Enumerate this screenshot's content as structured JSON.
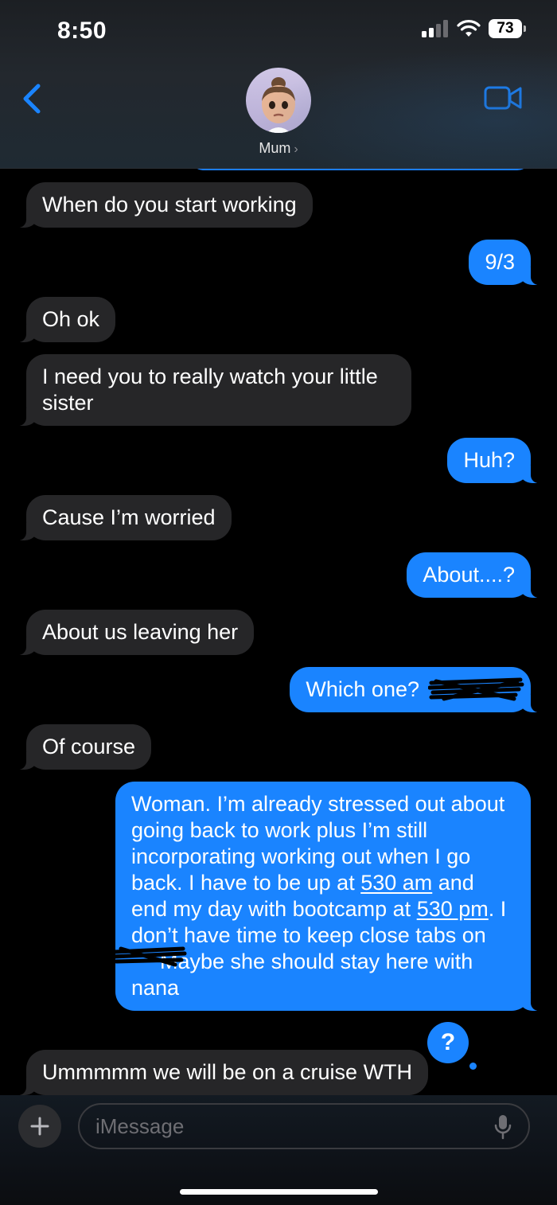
{
  "status_bar": {
    "time": "8:50",
    "battery": "73"
  },
  "header": {
    "contact_name": "Mum"
  },
  "messages": [
    {
      "side": "in",
      "text": "When do you start working"
    },
    {
      "side": "out",
      "text": "9/3"
    },
    {
      "side": "in",
      "text": "Oh ok"
    },
    {
      "side": "in",
      "text": "I need you to really watch your little sister"
    },
    {
      "side": "out",
      "text": "Huh?"
    },
    {
      "side": "in",
      "text": "Cause I’m worried"
    },
    {
      "side": "out",
      "text": "About....?"
    },
    {
      "side": "in",
      "text": "About us leaving her"
    },
    {
      "side": "out",
      "text": "Which one?"
    },
    {
      "side": "in",
      "text": "Of course"
    },
    {
      "side": "out",
      "parts": [
        "Woman. I’m already stressed out about going back to work plus I’m still incorporating working out when I go back. I have to be up at ",
        "530 am",
        " and end my day with bootcamp at ",
        "530 pm",
        ". I don’t have time to keep close tabs on ",
        "Maybe she should stay here with nana"
      ]
    },
    {
      "side": "in",
      "text": "Ummmmm we will be on a cruise WTH"
    }
  ],
  "badge": {
    "symbol": "?"
  },
  "compose": {
    "placeholder": "iMessage"
  },
  "colors": {
    "outgoing": "#1a84ff",
    "incoming": "#262628",
    "accent": "#1a7df5"
  }
}
